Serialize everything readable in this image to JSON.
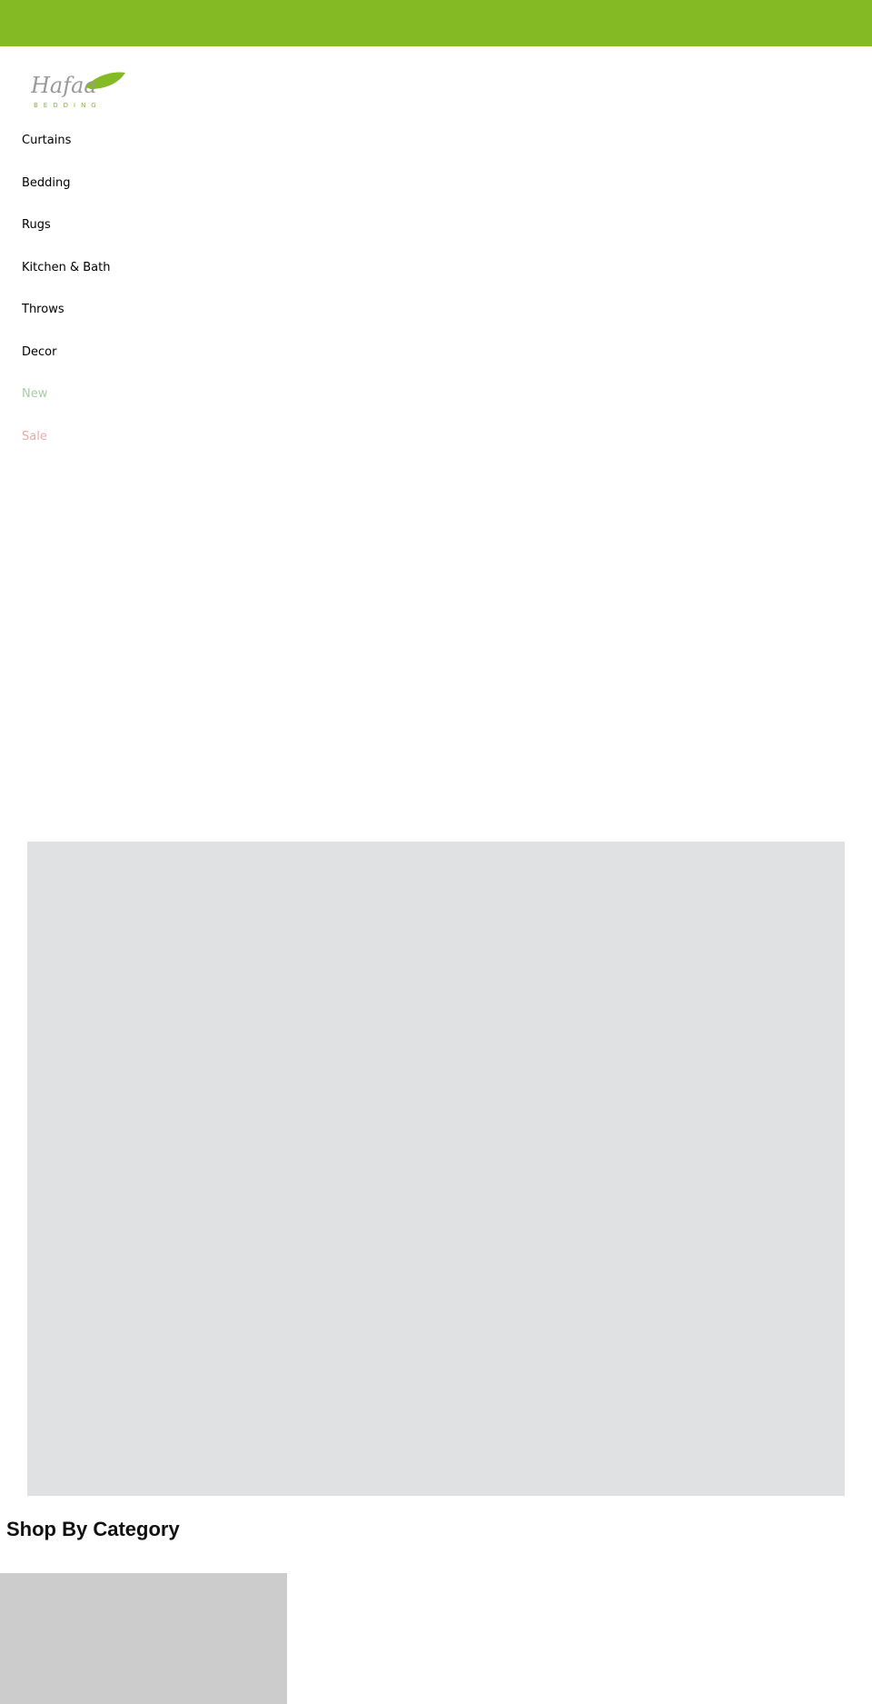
{
  "logo": {
    "script_text": "Hafaa",
    "sub_text": "BEDDING"
  },
  "colors": {
    "topbar": "#84ba23",
    "new": "#a8cca8",
    "sale": "#eaa9a9",
    "banner": "#e0e1e3",
    "tile": "#cccccc"
  },
  "nav": {
    "items": [
      {
        "label": "Curtains"
      },
      {
        "label": "Bedding"
      },
      {
        "label": "Rugs"
      },
      {
        "label": "Kitchen & Bath"
      },
      {
        "label": "Throws"
      },
      {
        "label": "Decor"
      },
      {
        "label": "New"
      },
      {
        "label": "Sale"
      }
    ]
  },
  "section": {
    "title": "Shop By Category"
  }
}
